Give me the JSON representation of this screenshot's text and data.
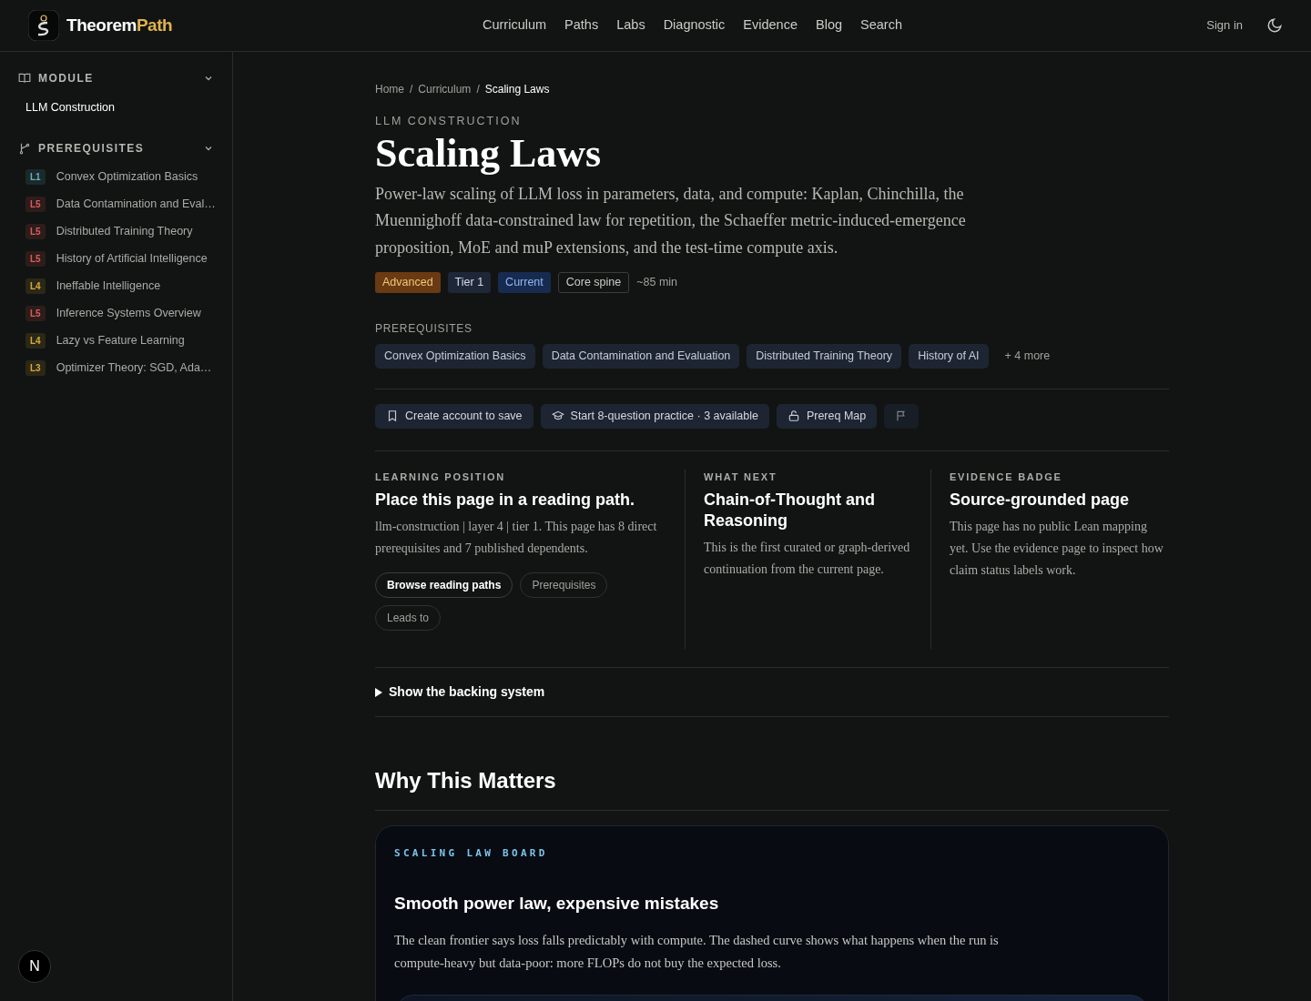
{
  "header": {
    "logo": {
      "first": "Theorem",
      "second": "Path"
    },
    "nav": [
      {
        "label": "Curriculum"
      },
      {
        "label": "Paths"
      },
      {
        "label": "Labs"
      },
      {
        "label": "Diagnostic"
      },
      {
        "label": "Evidence"
      },
      {
        "label": "Blog"
      },
      {
        "label": "Search"
      }
    ],
    "sign_in": "Sign in"
  },
  "sidebar": {
    "module": {
      "title": "MODULE",
      "expanded": true,
      "item": "LLM Construction"
    },
    "prerequisites": {
      "title": "PREREQUISITES",
      "expanded": true,
      "items": [
        {
          "level": "L1",
          "label": "Convex Optimization Basics",
          "color": "#5fb3c4"
        },
        {
          "level": "L5",
          "label": "Data Contamination and Eval…",
          "color": "#e05a5a"
        },
        {
          "level": "L5",
          "label": "Distributed Training Theory",
          "color": "#e05a5a"
        },
        {
          "level": "L5",
          "label": "History of Artificial Intelligence",
          "color": "#e05a5a"
        },
        {
          "level": "L4",
          "label": "Ineffable Intelligence",
          "color": "#d8a93a"
        },
        {
          "level": "L5",
          "label": "Inference Systems Overview",
          "color": "#e05a5a"
        },
        {
          "level": "L4",
          "label": "Lazy vs Feature Learning",
          "color": "#d8a93a"
        },
        {
          "level": "L3",
          "label": "Optimizer Theory: SGD, Ada…",
          "color": "#d8a93a"
        }
      ]
    },
    "dev_badge": "N"
  },
  "breadcrumb": [
    {
      "label": "Home",
      "current": false
    },
    {
      "label": "Curriculum",
      "current": false
    },
    {
      "label": "Scaling Laws",
      "current": true
    }
  ],
  "breadcrumb_separator": "/",
  "eyebrow": "LLM CONSTRUCTION",
  "title": "Scaling Laws",
  "summary": "Power-law scaling of LLM loss in parameters, data, and compute: Kaplan, Chinchilla, the Muennighoff data-constrained law for repetition, the Schaeffer metric-induced-emergence proposition, MoE and muP extensions, and the test-time compute axis.",
  "tags": [
    {
      "label": "Advanced",
      "kind": "difficulty"
    },
    {
      "label": "Tier 1",
      "kind": "tier"
    },
    {
      "label": "Current",
      "kind": "status"
    },
    {
      "label": "Core spine",
      "kind": "outline"
    },
    {
      "label": "~85 min",
      "kind": "plain"
    }
  ],
  "prerequisites": {
    "heading": "PREREQUISITES",
    "chips": [
      "Convex Optimization Basics",
      "Data Contamination and Evaluation",
      "Distributed Training Theory",
      "History of AI"
    ],
    "more": "+ 4 more"
  },
  "actions": [
    {
      "label": "Create account to save"
    },
    {
      "label": "Start 8-question practice · 3 available"
    },
    {
      "label": "Prereq Map"
    },
    {
      "kind": "icon_only"
    }
  ],
  "panels": [
    {
      "eyebrow": "LEARNING POSITION",
      "heading": "Place this page in a reading path.",
      "body": "llm-construction | layer 4 | tier 1. This page has 8 direct prerequisites and 7 published dependents.",
      "links": [
        {
          "label": "Browse reading paths",
          "selected": true
        },
        {
          "label": "Prerequisites",
          "selected": false
        },
        {
          "label": "Leads to",
          "selected": false
        }
      ]
    },
    {
      "eyebrow": "WHAT NEXT",
      "heading": "Chain-of-Thought and Reasoning",
      "body": "This is the first curated or graph-derived continuation from the current page."
    },
    {
      "eyebrow": "EVIDENCE BADGE",
      "heading": "Source-grounded page",
      "body": "This page has no public Lean mapping yet. Use the evidence page to inspect how claim status labels work."
    }
  ],
  "disclosure": {
    "label": "Show the backing system",
    "expanded": false
  },
  "section_title": "Why This Matters",
  "board": {
    "eyebrow": "SCALING LAW BOARD",
    "heading": "Smooth power law, expensive mistakes",
    "body": "The clean frontier says loss falls predictably with compute. The dashed curve shows what happens when the run is compute-heavy but data-poor: more FLOPs do not buy the expected loss."
  }
}
